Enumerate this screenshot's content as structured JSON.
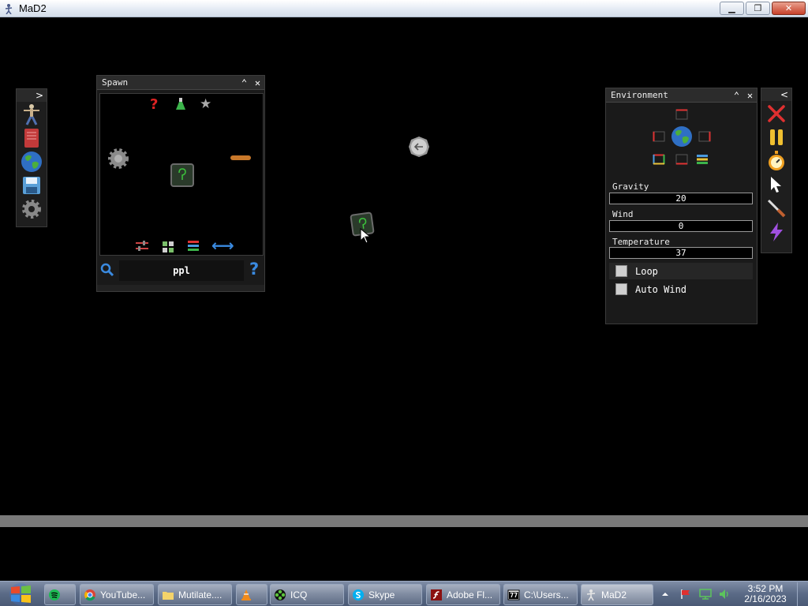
{
  "window": {
    "title": "MaD2",
    "min_glyph": "▁",
    "restore_glyph": "❐",
    "close_glyph": "✕"
  },
  "left_toolbar": {
    "toggle_glyph": ">",
    "items": [
      "ragdoll-icon",
      "book-icon",
      "globe-icon",
      "save-icon",
      "gear-icon"
    ]
  },
  "spawn_panel": {
    "title": "Spawn",
    "collapse_glyph": "⌃",
    "close_glyph": "✕",
    "search_value": "ppl",
    "help_glyph": "?",
    "top_icons": [
      "question-icon",
      "flask-icon",
      "star-icon"
    ],
    "bottom_icons": [
      "sliders-icon",
      "grid-icon",
      "layers-icon",
      "swap-arrows-icon"
    ],
    "question_glyph": "?",
    "star_glyph": "★",
    "swap_glyph": "⟷"
  },
  "environment_panel": {
    "title": "Environment",
    "collapse_glyph": "⌃",
    "close_glyph": "✕",
    "gravity_label": "Gravity",
    "gravity_value": "20",
    "wind_label": "Wind",
    "wind_value": "0",
    "temperature_label": "Temperature",
    "temperature_value": "37",
    "loop_label": "Loop",
    "auto_wind_label": "Auto Wind"
  },
  "right_toolbar": {
    "toggle_glyph": "<",
    "items": [
      "clear-x-icon",
      "pause-icon",
      "stopwatch-icon",
      "pointer-icon",
      "knife-icon",
      "lightning-icon"
    ]
  },
  "taskbar": {
    "items": [
      {
        "label": "",
        "icon": "spotify-icon"
      },
      {
        "label": "YouTube...",
        "icon": "chrome-icon"
      },
      {
        "label": "Mutilate....",
        "icon": "folder-icon"
      },
      {
        "label": "",
        "icon": "vlc-icon"
      },
      {
        "label": "ICQ",
        "icon": "icq-icon"
      },
      {
        "label": "Skype",
        "icon": "skype-icon"
      },
      {
        "label": "Adobe Fl...",
        "icon": "flash-icon"
      },
      {
        "label": "C:\\Users...",
        "icon": "7zip-icon"
      },
      {
        "label": "MaD2",
        "icon": "mad2-icon"
      }
    ],
    "clock_time": "3:52 PM",
    "clock_date": "2/16/2023"
  },
  "colors": {
    "background": "#000000",
    "ground": "#7a7a7a",
    "panel": "#1a1a1a",
    "taskbar": "#5a6a86"
  }
}
